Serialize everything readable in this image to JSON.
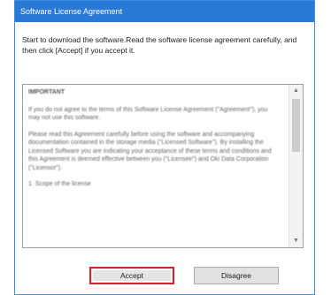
{
  "window": {
    "title": "Software License Agreement"
  },
  "intro_text": "Start to download the software.Read the software license agreement carefully, and then click [Accept] if you accept it.",
  "license": {
    "heading": "IMPORTANT",
    "paragraphs": [
      "If you do not agree to the terms of this Software License Agreement (\"Agreement\"), you may not use this software.",
      "Please read this Agreement carefully before using the software and accompanying documentation contained in the storage media (\"Licensed Software\"). By installing the Licensed Software you are indicating your acceptance of these terms and conditions and this Agreement is deemed effective between you (\"Licensee\") and Oki Data Corporation (\"Licensor\").",
      "1. Scope of the license"
    ]
  },
  "buttons": {
    "accept_label": "Accept",
    "disagree_label": "Disagree"
  },
  "colors": {
    "titlebar": "#2b79d6",
    "highlight_border": "#d0242f"
  }
}
